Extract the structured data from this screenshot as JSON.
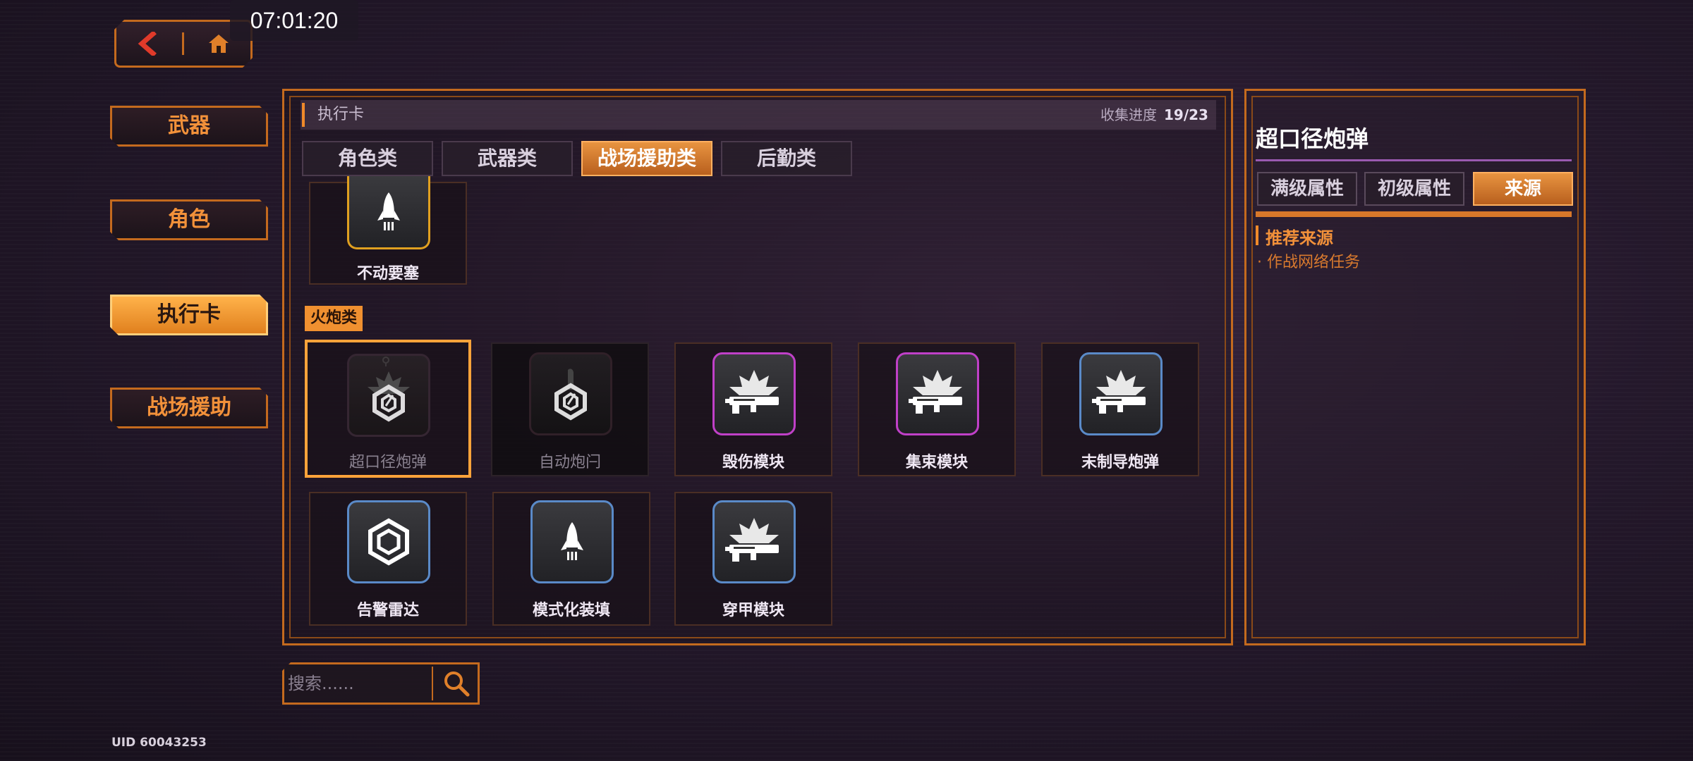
{
  "status_bar": {
    "time": "07:01:20"
  },
  "top_nav": {
    "back_icon": "chevron-left-icon",
    "home_icon": "home-icon"
  },
  "side_nav": [
    {
      "label": "武器",
      "active": false
    },
    {
      "label": "角色",
      "active": false
    },
    {
      "label": "执行卡",
      "active": true
    },
    {
      "label": "战场援助",
      "active": false
    }
  ],
  "main": {
    "section_title": "执行卡",
    "progress_label": "收集进度",
    "progress_value": "19/23",
    "tabs": [
      {
        "label": "角色类",
        "active": false
      },
      {
        "label": "武器类",
        "active": false
      },
      {
        "label": "战场援助类",
        "active": true
      },
      {
        "label": "后勤类",
        "active": false
      }
    ],
    "top_card": {
      "label": "不动要塞",
      "icon": "rocket-icon"
    },
    "category": "火炮类",
    "cards_row1": [
      {
        "label": "超口径炮弹",
        "icon": "hexagon-shell-icon",
        "state": "selected"
      },
      {
        "label": "自动炮闩",
        "icon": "hexagon-shell-icon",
        "state": "locked"
      },
      {
        "label": "毁伤模块",
        "icon": "rifle-burst-icon",
        "state": "owned"
      },
      {
        "label": "集束模块",
        "icon": "rifle-burst-icon",
        "state": "owned"
      },
      {
        "label": "末制导炮弹",
        "icon": "rifle-burst-icon",
        "state": "owned"
      }
    ],
    "cards_row2": [
      {
        "label": "告警雷达",
        "icon": "radar-hexagon-icon",
        "state": "owned"
      },
      {
        "label": "模式化装填",
        "icon": "rocket-icon",
        "state": "owned"
      },
      {
        "label": "穿甲模块",
        "icon": "rifle-burst-icon",
        "state": "owned"
      }
    ]
  },
  "detail": {
    "title": "超口径炮弹",
    "tabs": [
      {
        "label": "满级属性",
        "active": false
      },
      {
        "label": "初级属性",
        "active": false
      },
      {
        "label": "来源",
        "active": true
      }
    ],
    "rec_title": "推荐来源",
    "rec_items": [
      "· 作战网络任务"
    ]
  },
  "search": {
    "placeholder": "搜索......",
    "icon": "search-icon"
  },
  "uid": "UID 60043253",
  "colors": {
    "accent": "#f2913a",
    "border": "#c46a1e",
    "purple_frame": "#b040c0",
    "blue_frame": "#5a8ac8"
  }
}
